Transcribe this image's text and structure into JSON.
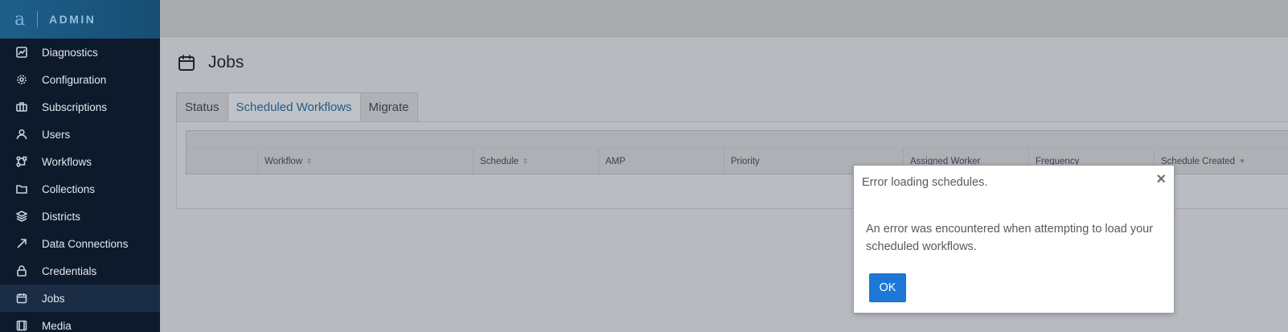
{
  "brand": {
    "logo": "a",
    "title": "ADMIN"
  },
  "sidebar": {
    "items": [
      {
        "label": "Diagnostics",
        "icon": "chart-line-icon"
      },
      {
        "label": "Configuration",
        "icon": "gear-icon"
      },
      {
        "label": "Subscriptions",
        "icon": "briefcase-icon"
      },
      {
        "label": "Users",
        "icon": "user-icon"
      },
      {
        "label": "Workflows",
        "icon": "workflow-icon"
      },
      {
        "label": "Collections",
        "icon": "folder-icon"
      },
      {
        "label": "Districts",
        "icon": "layers-icon"
      },
      {
        "label": "Data Connections",
        "icon": "link-arrow-icon"
      },
      {
        "label": "Credentials",
        "icon": "lock-icon"
      },
      {
        "label": "Jobs",
        "icon": "calendar-icon",
        "active": true
      },
      {
        "label": "Media",
        "icon": "film-icon"
      }
    ]
  },
  "page": {
    "title": "Jobs",
    "icon": "calendar-icon"
  },
  "tabs": [
    {
      "label": "Status"
    },
    {
      "label": "Scheduled Workflows",
      "active": true
    },
    {
      "label": "Migrate"
    }
  ],
  "table": {
    "columns": [
      {
        "label": "Workflow",
        "sort": "⇕"
      },
      {
        "label": "Schedule",
        "sort": "⇕"
      },
      {
        "label": "AMP",
        "sort": ""
      },
      {
        "label": "Priority",
        "sort": ""
      },
      {
        "label": "Assigned Worker",
        "sort": ""
      },
      {
        "label": "Frequency",
        "sort": ""
      },
      {
        "label": "Schedule Created",
        "sort": "▼"
      }
    ]
  },
  "modal": {
    "title": "Error loading schedules.",
    "close": "×",
    "body": "An error was encountered when attempting to load your scheduled workflows.",
    "ok": "OK"
  },
  "colors": {
    "sidebar": "#0d1a2b",
    "brand": "#1e5f8a",
    "accent": "#1d77d6",
    "active_tab_text": "#245c85"
  }
}
